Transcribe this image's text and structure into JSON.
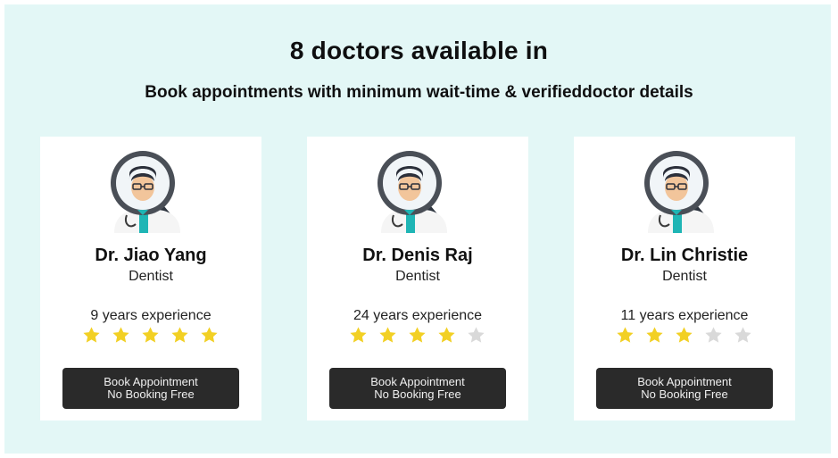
{
  "header": {
    "title": "8 doctors available in",
    "subtitle": "Book appointments with minimum wait-time & verifieddoctor details"
  },
  "colors": {
    "panel_bg": "#e3f7f6",
    "card_bg": "#ffffff",
    "button_bg": "#2a2a2a",
    "star_filled": "#f2d024",
    "star_empty": "#d9d9d9"
  },
  "doctors": [
    {
      "name": "Dr. Jiao Yang",
      "specialty": "Dentist",
      "experience": "9 years experience",
      "rating": 5,
      "button_line1": "Book Appointment",
      "button_line2": "No Booking Free",
      "avatar_icon": "doctor-magnifier-icon"
    },
    {
      "name": "Dr. Denis Raj",
      "specialty": "Dentist",
      "experience": "24 years experience",
      "rating": 4,
      "button_line1": "Book Appointment",
      "button_line2": "No Booking Free",
      "avatar_icon": "doctor-magnifier-icon"
    },
    {
      "name": "Dr. Lin Christie",
      "specialty": "Dentist",
      "experience": "11 years experience",
      "rating": 3,
      "button_line1": "Book Appointment",
      "button_line2": "No Booking Free",
      "avatar_icon": "doctor-magnifier-icon"
    }
  ],
  "rating_max": 5
}
